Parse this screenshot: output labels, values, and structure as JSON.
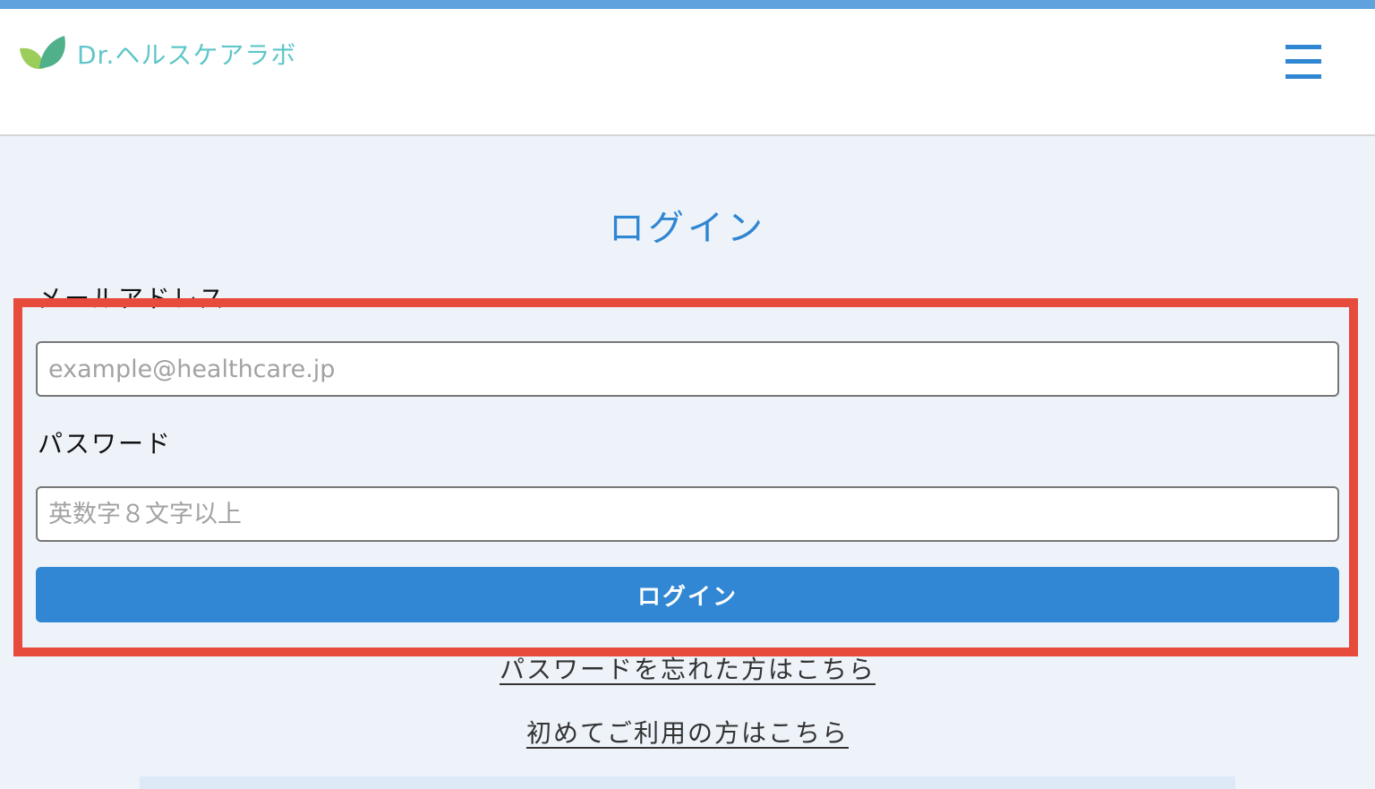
{
  "header": {
    "logo_text": "Dr.ヘルスケアラボ",
    "logo_icon": "leaf-icon",
    "menu_icon": "hamburger-menu-icon"
  },
  "page": {
    "title": "ログイン"
  },
  "form": {
    "email_label": "メールアドレス",
    "email_placeholder": "example@healthcare.jp",
    "email_value": "",
    "password_label": "パスワード",
    "password_placeholder": "英数字８文字以上",
    "password_value": "",
    "submit_label": "ログイン"
  },
  "links": {
    "forgot_password": "パスワードを忘れた方はこちら",
    "first_time": "初めてご利用の方はこちら"
  },
  "colors": {
    "accent": "#2f86d2",
    "top_bar": "#5fa2dd",
    "background": "#eef3fa",
    "highlight": "#e64b3c",
    "logo_text": "#5fc6c9",
    "leaf_light": "#9ccc5a",
    "leaf_dark": "#4fb08a"
  }
}
